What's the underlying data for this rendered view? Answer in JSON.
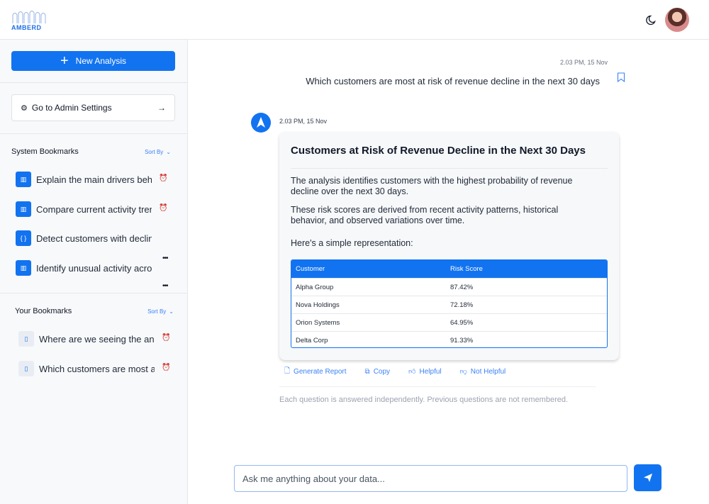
{
  "brand": {
    "logo_text": "AMBERD",
    "accent": "#1273f0"
  },
  "header": {
    "theme_icon": "moon-icon",
    "avatar": "user-avatar"
  },
  "sidebar": {
    "new_analysis_label": "New Analysis",
    "admin_label": "Go to Admin Settings",
    "system_bookmarks": {
      "title": "System Bookmarks",
      "sort_label": "Sort By",
      "items": [
        {
          "label": "Explain the main drivers behind",
          "icon": "chart-icon"
        },
        {
          "label": "Compare current activity trends",
          "icon": "chart-icon"
        },
        {
          "label": "Detect customers with declining",
          "icon": "code-icon"
        },
        {
          "label": "Identify unusual activity across",
          "icon": "chart-icon"
        }
      ]
    },
    "your_bookmarks": {
      "title": "Your Bookmarks",
      "sort_label": "Sort By",
      "items": [
        {
          "label": "Where are we seeing the anomalies",
          "icon": "bookmark-icon"
        },
        {
          "label": "Which customers are most at risk",
          "icon": "bookmark-icon"
        }
      ]
    }
  },
  "chat": {
    "user_timestamp": "2.03 PM, 15 Nov",
    "user_question": "Which customers are most at risk of revenue decline in the next 30 days",
    "bot_timestamp": "2.03 PM, 15 Nov",
    "card": {
      "title": "Customers at Risk of Revenue Decline in the Next 30 Days",
      "para1": "The analysis identifies customers with the highest probability of revenue decline over the next 30 days.",
      "para2": "These risk scores are derived from recent activity patterns, historical behavior, and observed variations over time.",
      "para3": "Here's a simple representation:",
      "table": {
        "headers": [
          "Customer",
          "Risk Score"
        ],
        "rows": [
          [
            "Alpha Group",
            "87.42%"
          ],
          [
            "Nova Holdings",
            "72.18%"
          ],
          [
            "Orion Systems",
            "64.95%"
          ],
          [
            "Delta Corp",
            "91.33%"
          ]
        ]
      }
    },
    "actions": {
      "generate_report": "Generate Report",
      "copy": "Copy",
      "helpful": "Helpful",
      "not_helpful": "Not Helpful"
    },
    "disclaimer": "Each question is answered independently. Previous questions are not remembered."
  },
  "composer": {
    "placeholder": "Ask me anything about your data..."
  }
}
